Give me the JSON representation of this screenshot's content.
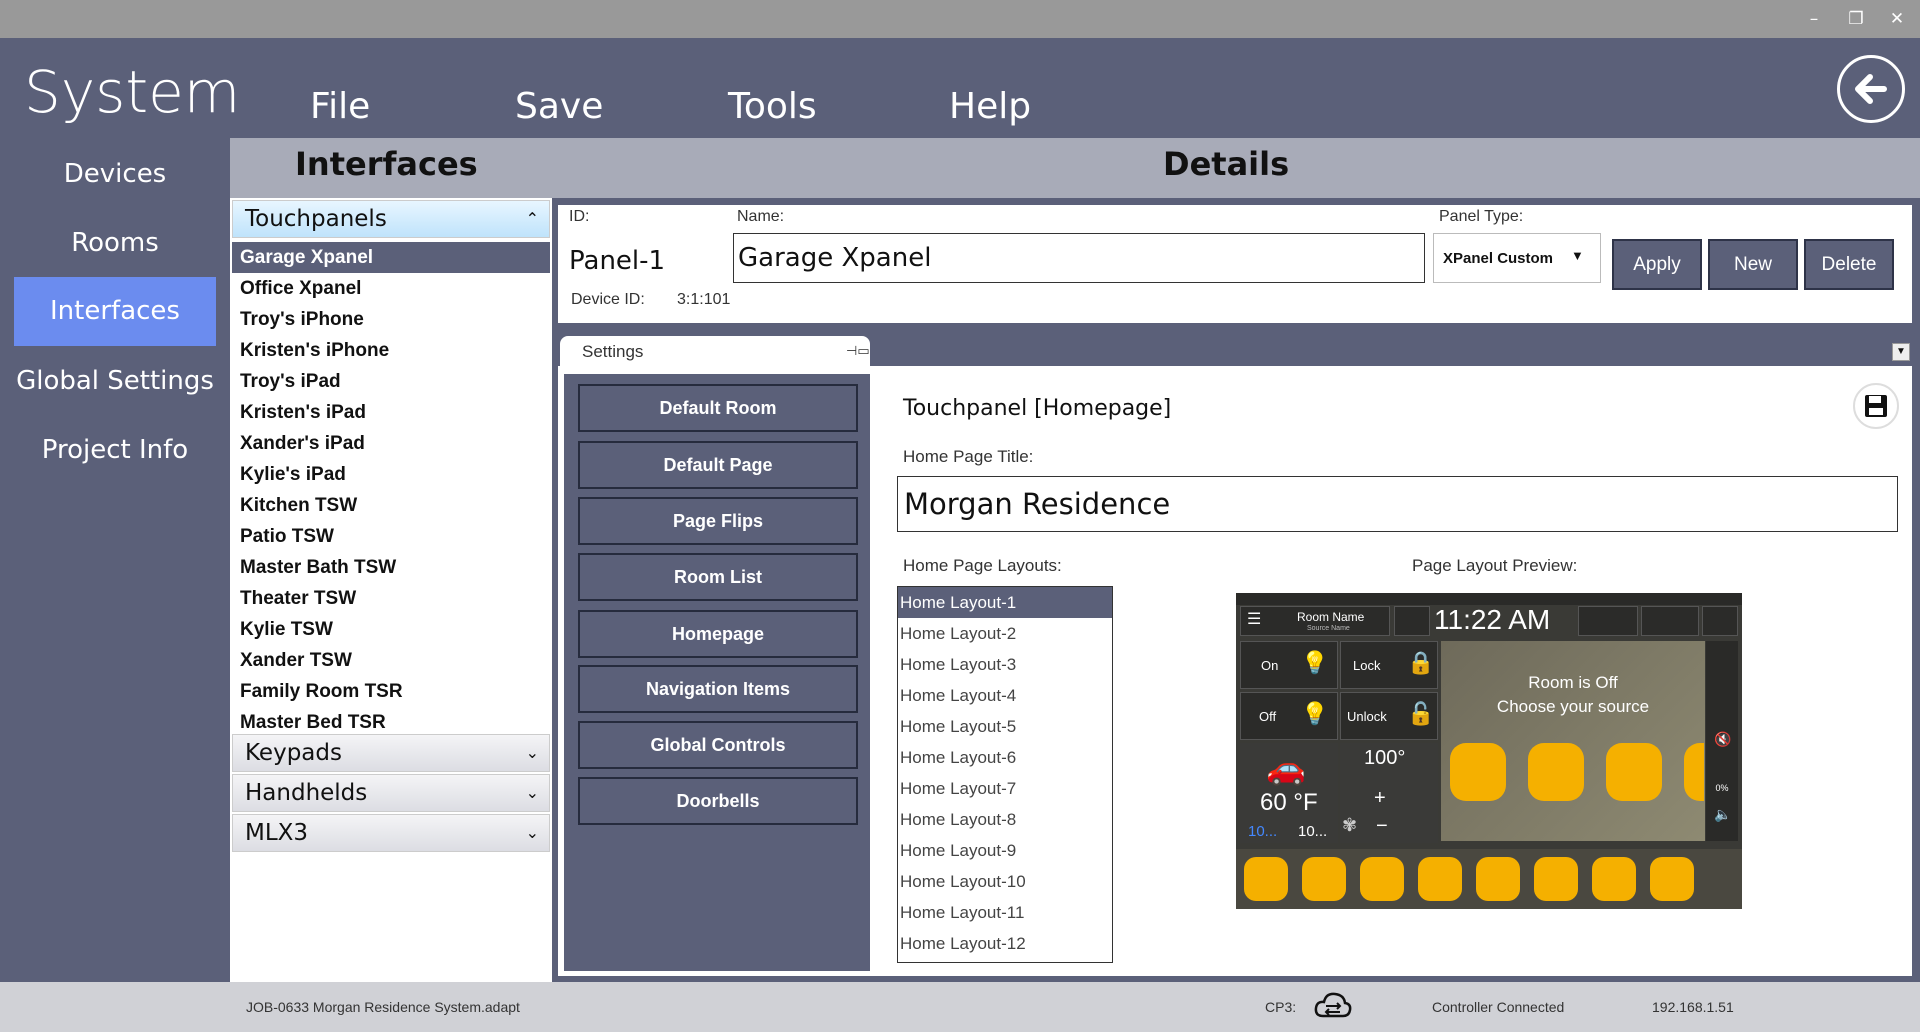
{
  "window": {
    "minimize": "–",
    "restore": "❐",
    "close": "✕"
  },
  "app": {
    "title": "System"
  },
  "menu": [
    "File",
    "Save",
    "Tools",
    "Help"
  ],
  "nav": [
    {
      "label": "Devices",
      "active": false
    },
    {
      "label": "Rooms",
      "active": false
    },
    {
      "label": "Interfaces",
      "active": true
    },
    {
      "label": "Global Settings",
      "active": false
    },
    {
      "label": "Project Info",
      "active": false
    }
  ],
  "interfaces": {
    "header": "Interfaces",
    "groups": {
      "touchpanels": "Touchpanels",
      "keypads": "Keypads",
      "handhelds": "Handhelds",
      "mlx3": "MLX3"
    },
    "touchpanels": [
      "Garage Xpanel",
      "Office Xpanel",
      "Troy's iPhone",
      "Kristen's iPhone",
      "Troy's iPad",
      "Kristen's iPad",
      "Xander's iPad",
      "Kylie's iPad",
      "Kitchen TSW",
      "Patio TSW",
      "Master Bath TSW",
      "Theater TSW",
      "Kylie TSW",
      "Xander TSW",
      "Family Room TSR",
      "Master Bed TSR"
    ],
    "selected": "Garage Xpanel"
  },
  "details": {
    "header": "Details",
    "id_label": "ID:",
    "id_value": "Panel-1",
    "device_id_label": "Device ID:",
    "device_id_value": "3:1:101",
    "name_label": "Name:",
    "name_value": "Garage Xpanel",
    "panel_type_label": "Panel Type:",
    "panel_type_value": "XPanel Custom",
    "apply": "Apply",
    "new": "New",
    "delete": "Delete"
  },
  "settings": {
    "tab_label": "Settings",
    "buttons": [
      "Default Room",
      "Default Page",
      "Page Flips",
      "Room List",
      "Homepage",
      "Navigation Items",
      "Global Controls",
      "Doorbells"
    ]
  },
  "homepage": {
    "title": "Touchpanel [Homepage]",
    "home_title_label": "Home Page Title:",
    "home_title_value": "Morgan Residence",
    "layouts_label": "Home Page Layouts:",
    "preview_label": "Page Layout Preview:",
    "layouts": [
      "Home Layout-1",
      "Home Layout-2",
      "Home Layout-3",
      "Home Layout-4",
      "Home Layout-5",
      "Home Layout-6",
      "Home Layout-7",
      "Home Layout-8",
      "Home Layout-9",
      "Home Layout-10",
      "Home Layout-11",
      "Home Layout-12"
    ],
    "selected_layout": "Home Layout-1"
  },
  "preview": {
    "room_name": "Room Name",
    "source_name": "Source Name",
    "time": "11:22 AM",
    "on": "On",
    "off": "Off",
    "lock": "Lock",
    "unlock": "Unlock",
    "room_off_line1": "Room is Off",
    "room_off_line2": "Choose your source",
    "weather_temp": "60 °F",
    "setpoint": "100°",
    "weather_low": "10...",
    "weather_high": "10...",
    "volume_pct": "0%"
  },
  "status": {
    "file": "JOB-0633 Morgan Residence System.adapt",
    "cp3_label": "CP3:",
    "controller": "Controller Connected",
    "ip": "192.168.1.51"
  },
  "colors": {
    "accent": "#6b8cef",
    "chrome": "#5b6079",
    "selection": "#5b6079"
  }
}
